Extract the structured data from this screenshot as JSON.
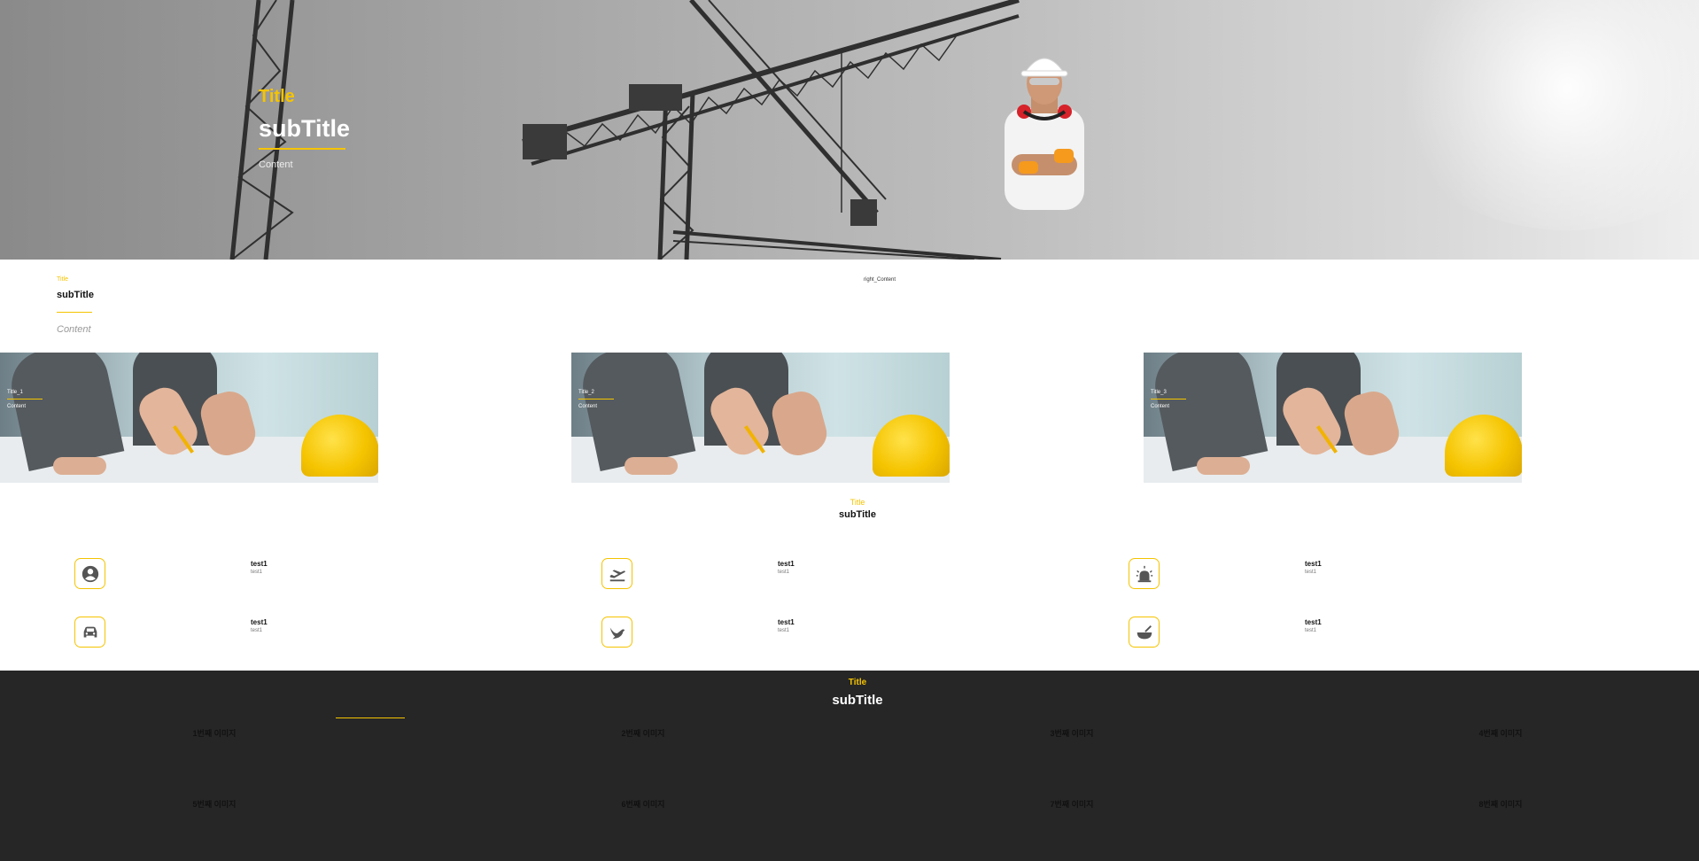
{
  "hero": {
    "title": "Title",
    "subtitle": "subTitle",
    "content": "Content"
  },
  "intro": {
    "title": "Title",
    "subtitle": "subTitle",
    "content": "Content",
    "right_content": "right_Content"
  },
  "cards": [
    {
      "title": "Title_1",
      "content": "Content"
    },
    {
      "title": "Title_2",
      "content": "Content"
    },
    {
      "title": "Title_3",
      "content": "Content"
    }
  ],
  "features": {
    "title": "Title",
    "subtitle": "subTitle",
    "items": [
      {
        "icon": "account-circle-icon",
        "heading": "test1",
        "text": "test1"
      },
      {
        "icon": "airplane-takeoff-icon",
        "heading": "test1",
        "text": "test1"
      },
      {
        "icon": "alarm-light-icon",
        "heading": "test1",
        "text": "test1"
      },
      {
        "icon": "car-icon",
        "heading": "test1",
        "text": "test1"
      },
      {
        "icon": "bird-icon",
        "heading": "test1",
        "text": "test1"
      },
      {
        "icon": "bowl-spoon-icon",
        "heading": "test1",
        "text": "test1"
      }
    ]
  },
  "gallery": {
    "title": "Title",
    "subtitle": "subTitle",
    "items": [
      "1번째 이미지",
      "2번째 이미지",
      "3번째 이미지",
      "4번째 이미지",
      "5번째 이미지",
      "6번째 이미지",
      "7번째 이미지",
      "8번째 이미지"
    ]
  },
  "colors": {
    "accent": "#f5c400",
    "dark_bg": "#262626"
  }
}
